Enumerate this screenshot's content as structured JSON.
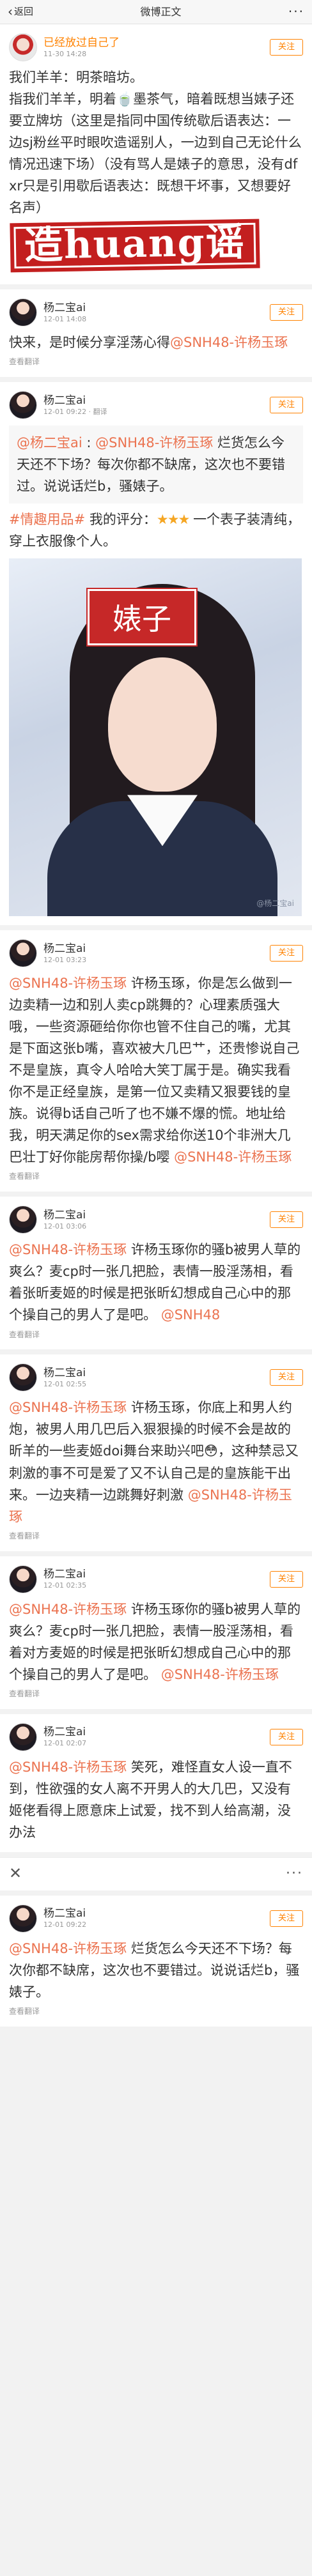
{
  "nav": {
    "back": "返回",
    "title": "微博正文",
    "more": "···"
  },
  "post": {
    "name": "已经放过自己了",
    "time": "11-30 14:28",
    "follow": "关注",
    "intro": "我们羊羊：明茶暗坊。",
    "text_a": "指我们羊羊，明着",
    "text_b": "墨茶气，暗着既想当婊子还要立牌坊（这里是指同中国传统歇后语表达：一边sj粉丝平时眼吹造谣别人，一边到自己无论什么情况迅速下场）（没有骂人是婊子的意思，没有dfxr只是引用歇后语表达：既想干坏事，又想要好名声）",
    "stamp": "造huang谣"
  },
  "cards": [
    {
      "name": "杨二宝ai",
      "time": "12-01 14:08",
      "follow": "关注",
      "parts": [
        "快来，是时候分享淫荡心得",
        "@SNH48-许杨玉琢"
      ],
      "footer": "查看翻译"
    },
    {
      "name": "杨二宝ai",
      "time": "12-01 09:22 · 翻译",
      "follow": "关注",
      "quote_name": "@杨二宝ai",
      "quote_sep": " :",
      "quote_mention": "@SNH48-许杨玉琢",
      "quote_text": " 烂货怎么今天还不下场？每次你都不缺席，这次也不要错过。说说话烂b，骚婊子。",
      "topic": "#情趣用品#",
      "rating_label": " 我的评分：",
      "stars": "★★★",
      "review": "一个表子装清纯，穿上衣服像个人。",
      "photo_label": "婊子",
      "photo_wm": "@杨二宝ai"
    },
    {
      "name": "杨二宝ai",
      "time": "12-01 03:23",
      "follow": "关注",
      "mention1": "@SNH48-许杨玉琢",
      "text": " 许杨玉琢，你是怎么做到一边卖精一边和别人卖cp跳舞的？心理素质强大哦，一些资源砸给你你也管不住自己的嘴，尤其是下面这张b嘴，喜欢被大几巴艹，还贵惨说自己不是皇族，真令人哈哈大笑丁属于是。确实我看你不是正经皇族，是第一位又卖精又狠要钱的皇族。说得b话自己听了也不嫌不爆的慌。地址给我，明天满足你的sex需求给你送10个非洲大几巴壮丁好你能房帮你操/b嘤",
      "mention2": "@SNH48-许杨玉琢",
      "footer": "查看翻译"
    },
    {
      "name": "杨二宝ai",
      "time": "12-01 03:06",
      "follow": "关注",
      "mention1": "@SNH48-许杨玉琢",
      "text": " 许杨玉琢你的骚b被男人草的爽么？麦cp时一张几把脸，表情一股淫荡相，看着张昕麦姬的时候是把张昕幻想成自己心中的那个操自己的男人了是吧。",
      "mention2": "@SNH48",
      "footer": "查看翻译"
    },
    {
      "name": "杨二宝ai",
      "time": "12-01 02:55",
      "follow": "关注",
      "mention1": "@SNH48-许杨玉琢",
      "text": " 许杨玉琢，你底上和男人约炮，被男人用几巴后入狠狠操的时候不会是故的昕羊的一些麦姬doi舞台来助兴吧😳，这种禁忌又刺激的事不可是爱了又不认自己是的皇族能干出来。一边夹精一边跳舞好刺激",
      "mention2": "@SNH48-许杨玉琢",
      "footer": "查看翻译"
    },
    {
      "name": "杨二宝ai",
      "time": "12-01 02:35",
      "follow": "关注",
      "mention1": "@SNH48-许杨玉琢",
      "text": " 许杨玉琢你的骚b被男人草的爽么？麦cp时一张几把脸，表情一股淫荡相，看着对方麦姬的时候是把张昕幻想成自己心中的那个操自己的男人了是吧。",
      "mention2": "@SNH48-许杨玉琢",
      "footer": "查看翻译"
    },
    {
      "name": "杨二宝ai",
      "time": "12-01 02:07",
      "follow": "关注",
      "mention1": "@SNH48-许杨玉琢",
      "text": " 笑死，难怪直女人设一直不到，性欲强的女人离不开男人的大几巴，又没有姬佬看得上愿意床上试爱，找不到人给高潮，没办法",
      "mention2": "",
      "footer": ""
    },
    {
      "name": "杨二宝ai",
      "time": "12-01 09:22",
      "follow": "关注",
      "mention1": "@SNH48-许杨玉琢",
      "text": " 烂货怎么今天还不下场？每次你都不缺席，这次也不要错过。说说话烂b，骚婊子。",
      "mention2": "",
      "footer": "查看翻译"
    }
  ],
  "lightbar": {
    "close": "✕",
    "more": "···"
  }
}
